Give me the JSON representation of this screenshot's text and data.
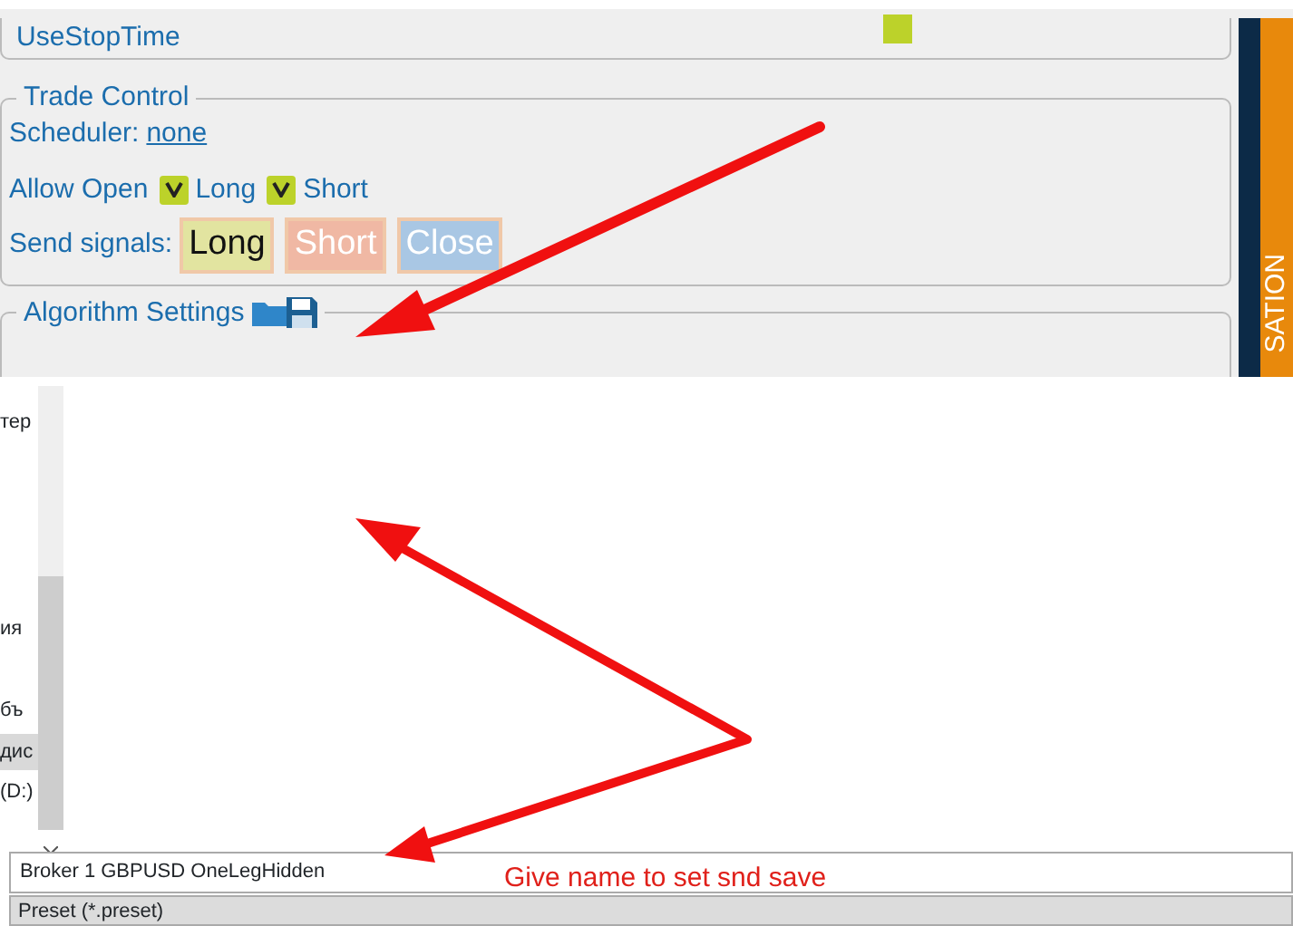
{
  "settings_panel": {
    "use_stop_time": {
      "label": "UseStopTime",
      "checked": true
    },
    "trade_control": {
      "title": "Trade Control",
      "scheduler_label": "Scheduler:",
      "scheduler_value": "none",
      "allow_open_label": "Allow Open",
      "allow_options": [
        {
          "label": "Long",
          "checked": true
        },
        {
          "label": "Short",
          "checked": true
        }
      ],
      "send_signals_label": "Send signals:",
      "signal_buttons": [
        {
          "label": "Long",
          "kind": "long"
        },
        {
          "label": "Short",
          "kind": "short"
        },
        {
          "label": "Close",
          "kind": "close"
        }
      ]
    },
    "algorithm_settings": {
      "title": "Algorithm Settings"
    },
    "side_tab": {
      "label": "SATION"
    }
  },
  "file_dialog": {
    "nav_items": [
      {
        "label": "тер",
        "selected": false
      },
      {
        "label": "ия",
        "selected": false
      },
      {
        "label": "бъ",
        "selected": false
      },
      {
        "label": "дис",
        "selected": true
      },
      {
        "label": "(D:)",
        "selected": false
      }
    ],
    "file_name": "Broker 1 GBPUSD OneLegHidden",
    "file_type": "Preset (*.preset)"
  },
  "annotation": {
    "text": "Give name to set snd save"
  }
}
